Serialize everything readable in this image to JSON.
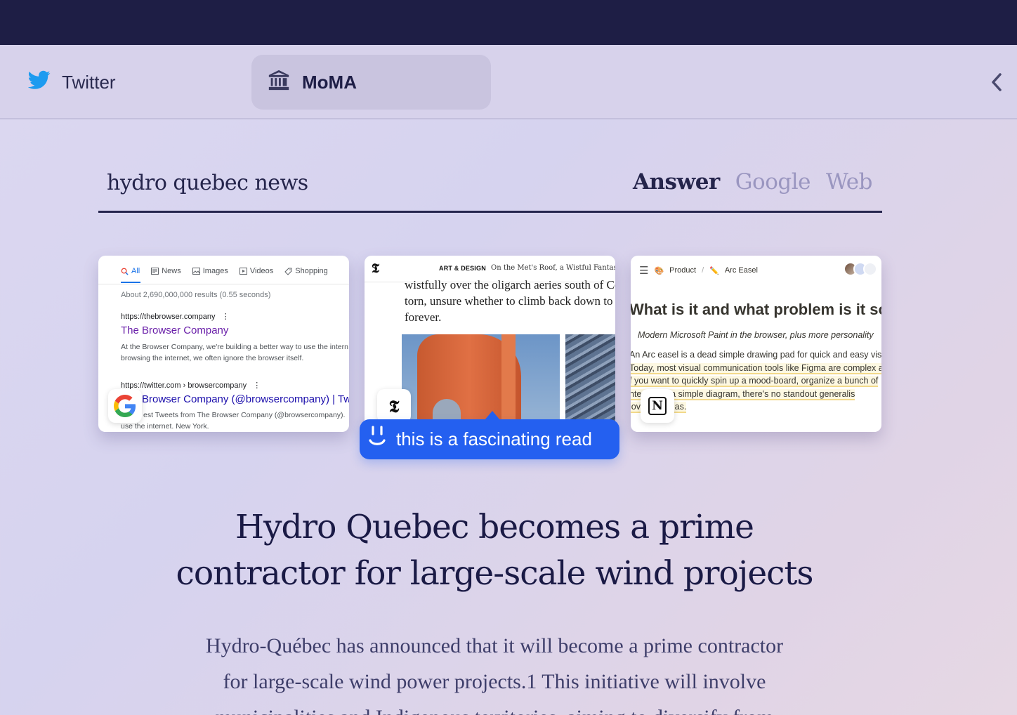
{
  "tabs": [
    {
      "label": "Twitter",
      "icon": "twitter-bird-icon"
    },
    {
      "label": "MoMA",
      "icon": "museum-icon",
      "active": true
    }
  ],
  "search": {
    "query": "hydro quebec news",
    "modes": [
      "Answer",
      "Google",
      "Web"
    ],
    "active_mode": "Answer"
  },
  "cards": {
    "google": {
      "tabs": [
        "All",
        "News",
        "Images",
        "Videos",
        "Shopping"
      ],
      "stats": "About 2,690,000,000 results (0.55 seconds)",
      "result1_url": "https://thebrowser.company",
      "result1_title": "The Browser Company",
      "result1_snippet_line1": "At the Browser Company, we're building a better way to use the intern",
      "result1_snippet_line2": "browsing the internet, we often ignore the browser itself.",
      "result2_url": "https://twitter.com › browsercompany",
      "result2_title": "Browser Company (@browsercompany) | Tw",
      "result2_snippet_line1": "est Tweets from The Browser Company (@browsercompany).",
      "result2_snippet_line2": "use the internet. New York."
    },
    "nyt": {
      "logo": "𝕿",
      "section": "ART & DESIGN",
      "headline": "On the Met's Roof, a Wistful Fantasy Wi",
      "body_line1": "wistfully over the oligarch aeries south of Ce",
      "body_line2": "torn, unsure whether to climb back down to",
      "body_line3": "forever."
    },
    "notion": {
      "breadcrumb_1": "Product",
      "breadcrumb_sep": "/",
      "breadcrumb_2": "Arc Easel",
      "title": "What is it and what problem is it sol",
      "subtitle": "Modern Microsoft Paint in the browser, plus more personality",
      "line1": "An Arc easel is a dead simple drawing pad for quick and easy visu",
      "line2": "Today, most visual communication tools like Figma are complex ar",
      "line3": "f you want to quickly spin up a mood-board, organize a bunch of",
      "line4": "nte       create a simple diagram, there's no standout generalis",
      "line5": "lov       near ideas.",
      "badge_letter": "N"
    }
  },
  "comment": {
    "text": "this is a fascinating read",
    "color": "#2460f0"
  },
  "answer": {
    "title_line1": "Hydro Quebec becomes a prime",
    "title_line2": "contractor for large-scale wind projects",
    "body_line1": "Hydro-Québec has announced that it will become a prime contractor",
    "body_line2": "for large-scale wind power projects.1 This initiative will involve",
    "body_line3": "municipalities and Indigenous territories, aiming to diversify from"
  },
  "colors": {
    "topbar": "#1e1e45",
    "accent_blue": "#2460f0",
    "text_dark": "#1a1a45"
  }
}
